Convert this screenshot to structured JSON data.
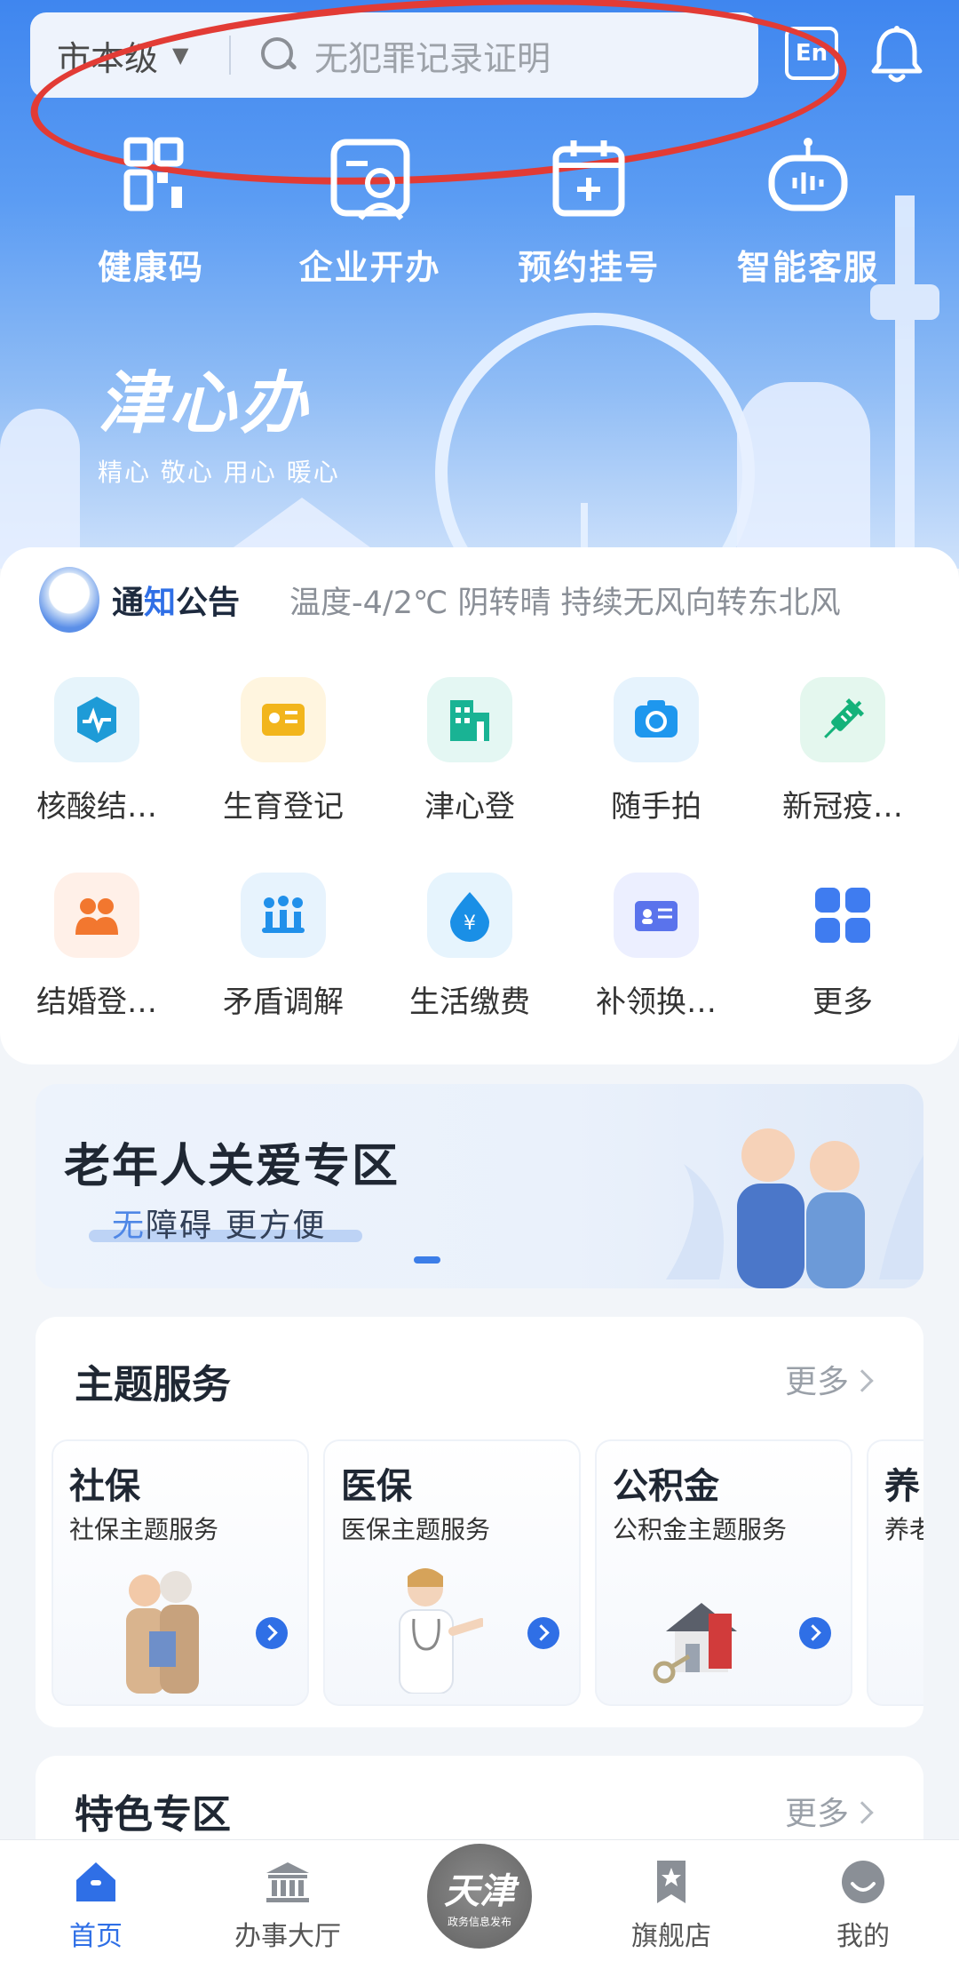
{
  "header": {
    "city": "市本级",
    "search_placeholder": "无犯罪记录证明",
    "lang_button": "En",
    "quick_actions": [
      {
        "label": "健康码",
        "icon": "qr-code-icon"
      },
      {
        "label": "企业开办",
        "icon": "business-card-icon"
      },
      {
        "label": "预约挂号",
        "icon": "calendar-plus-icon"
      },
      {
        "label": "智能客服",
        "icon": "robot-icon"
      }
    ],
    "brand": "津心办",
    "brand_slogan": "精心 敬心 用心 暖心"
  },
  "notice": {
    "title_a": "通",
    "title_b": "知",
    "title_c": "公告",
    "message": "温度-4/2℃ 阴转晴 持续无风向转东北风"
  },
  "services": [
    {
      "label": "核酸结…",
      "icon": "heartbeat-icon",
      "bg": "#e6f4fb",
      "fg": "#1e9bd7"
    },
    {
      "label": "生育登记",
      "icon": "id-card-icon",
      "bg": "#fff5df",
      "fg": "#f2b51c"
    },
    {
      "label": "津心登",
      "icon": "building-icon",
      "bg": "#e4f7f3",
      "fg": "#19b394"
    },
    {
      "label": "随手拍",
      "icon": "camera-icon",
      "bg": "#e6f3fd",
      "fg": "#1e97ee"
    },
    {
      "label": "新冠疫…",
      "icon": "syringe-icon",
      "bg": "#e4f7ee",
      "fg": "#14b27a"
    },
    {
      "label": "结婚登…",
      "icon": "couple-icon",
      "bg": "#fff0e8",
      "fg": "#f2772f"
    },
    {
      "label": "矛盾调解",
      "icon": "meeting-icon",
      "bg": "#e7f3fd",
      "fg": "#2190ea"
    },
    {
      "label": "生活缴费",
      "icon": "yuan-drop-icon",
      "bg": "#e6f4fd",
      "fg": "#1a8fe6"
    },
    {
      "label": "补领换…",
      "icon": "id-badge-icon",
      "bg": "#ecefff",
      "fg": "#5a73ec"
    },
    {
      "label": "更多",
      "icon": "grid-more-icon",
      "bg": "#ffffff",
      "fg": "#3f7cf0"
    }
  ],
  "elder_banner": {
    "title": "老年人关爱专区",
    "subtitle_highlight": "无",
    "subtitle_rest": "障碍 更方便"
  },
  "theme_services": {
    "title": "主题服务",
    "more": "更多",
    "cards": [
      {
        "title": "社保",
        "subtitle": "社保主题服务"
      },
      {
        "title": "医保",
        "subtitle": "医保主题服务"
      },
      {
        "title": "公积金",
        "subtitle": "公积金主题服务"
      },
      {
        "title": "养",
        "subtitle": "养老"
      }
    ]
  },
  "feature_zone": {
    "title": "特色专区",
    "more": "更多"
  },
  "tabbar": {
    "items": [
      {
        "label": "首页",
        "icon": "home-icon",
        "active": true
      },
      {
        "label": "办事大厅",
        "icon": "bank-icon",
        "active": false
      },
      {
        "label": "天津",
        "sub": "政务信息发布",
        "icon": "tianjin-logo-icon",
        "active": false
      },
      {
        "label": "旗舰店",
        "icon": "bookmark-star-icon",
        "active": false
      },
      {
        "label": "我的",
        "icon": "user-smile-icon",
        "active": false
      }
    ]
  },
  "colors": {
    "primary": "#2f6fe6",
    "annotation": "#e23b35"
  }
}
